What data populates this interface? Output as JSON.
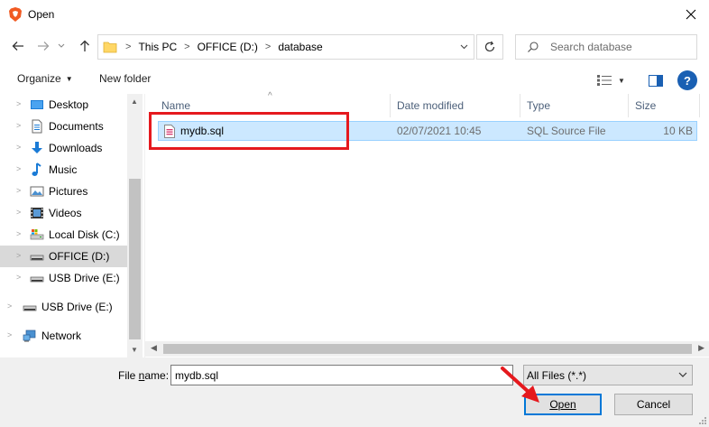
{
  "window": {
    "title": "Open"
  },
  "address": {
    "crumbs": [
      "This PC",
      "OFFICE (D:)",
      "database"
    ]
  },
  "search": {
    "placeholder": "Search database"
  },
  "toolbar": {
    "organize_label": "Organize",
    "new_folder_label": "New folder",
    "help_label": "?"
  },
  "sidebar": {
    "items": [
      {
        "label": "Desktop",
        "icon": "desktop-icon"
      },
      {
        "label": "Documents",
        "icon": "documents-icon"
      },
      {
        "label": "Downloads",
        "icon": "downloads-icon"
      },
      {
        "label": "Music",
        "icon": "music-icon"
      },
      {
        "label": "Pictures",
        "icon": "pictures-icon"
      },
      {
        "label": "Videos",
        "icon": "videos-icon"
      },
      {
        "label": "Local Disk (C:)",
        "icon": "local-disk-icon"
      },
      {
        "label": "OFFICE (D:)",
        "icon": "drive-icon",
        "selected": true
      },
      {
        "label": "USB Drive (E:)",
        "icon": "usb-drive-icon"
      },
      {
        "label": "USB Drive (E:)",
        "icon": "usb-drive-icon"
      },
      {
        "label": "Network",
        "icon": "network-icon"
      }
    ]
  },
  "columns": {
    "name": "Name",
    "date": "Date modified",
    "type": "Type",
    "size": "Size"
  },
  "files": [
    {
      "name": "mydb.sql",
      "date": "02/07/2021 10:45",
      "type": "SQL Source File",
      "size": "10 KB"
    }
  ],
  "bottom": {
    "file_name_label_pre": "File ",
    "file_name_label_u": "n",
    "file_name_label_post": "ame:",
    "file_name_value": "mydb.sql",
    "file_type_value": "All Files (*.*)",
    "open_label": "Open",
    "cancel_label": "Cancel"
  },
  "colors": {
    "accent": "#0078d7",
    "selection": "#cce8ff",
    "annotation": "#e5191e"
  }
}
